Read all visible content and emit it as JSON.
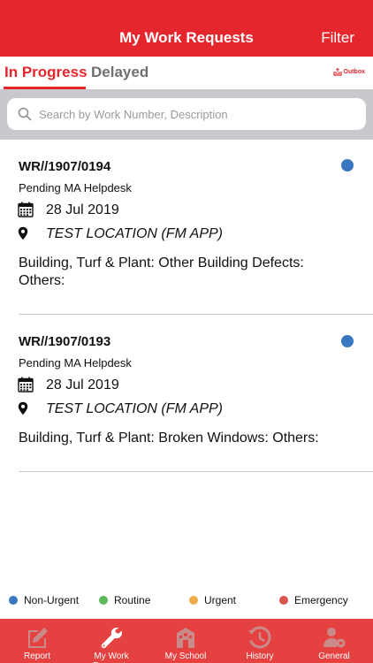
{
  "header": {
    "title": "My Work Requests",
    "filter_label": "Filter"
  },
  "tabs": [
    {
      "label": "In Progress",
      "active": true
    },
    {
      "label": "Delayed",
      "active": false
    }
  ],
  "outbox": {
    "label": "Outbox",
    "icon": "outbox-icon"
  },
  "search": {
    "placeholder": "Search by Work Number, Description",
    "value": ""
  },
  "requests": [
    {
      "number": "WR//1907/0194",
      "status": "Pending MA Helpdesk",
      "date": "28 Jul 2019",
      "location": "TEST LOCATION (FM APP)",
      "description": "Building, Turf & Plant: Other Building Defects: Others:",
      "priority_color": "#3978c0"
    },
    {
      "number": "WR//1907/0193",
      "status": "Pending MA Helpdesk",
      "date": "28 Jul 2019",
      "location": "TEST LOCATION (FM APP)",
      "description": "Building, Turf & Plant: Broken Windows: Others:",
      "priority_color": "#3978c0"
    }
  ],
  "legend": [
    {
      "label": "Non-Urgent",
      "color": "#3978c0"
    },
    {
      "label": "Routine",
      "color": "#5cb85c"
    },
    {
      "label": "Urgent",
      "color": "#f0ad4e"
    },
    {
      "label": "Emergency",
      "color": "#d9534f"
    }
  ],
  "tabbar": [
    {
      "label": "Report",
      "icon": "edit-icon",
      "active": false
    },
    {
      "label": "My Work Requests",
      "icon": "wrench-icon",
      "active": true
    },
    {
      "label": "My School",
      "icon": "school-icon",
      "active": false
    },
    {
      "label": "History",
      "icon": "history-icon",
      "active": false
    },
    {
      "label": "General",
      "icon": "user-gear-icon",
      "active": false
    }
  ],
  "colors": {
    "brand_red": "#e5262d",
    "tabbar_red": "#e64141",
    "search_bg": "#c9c9cd"
  }
}
